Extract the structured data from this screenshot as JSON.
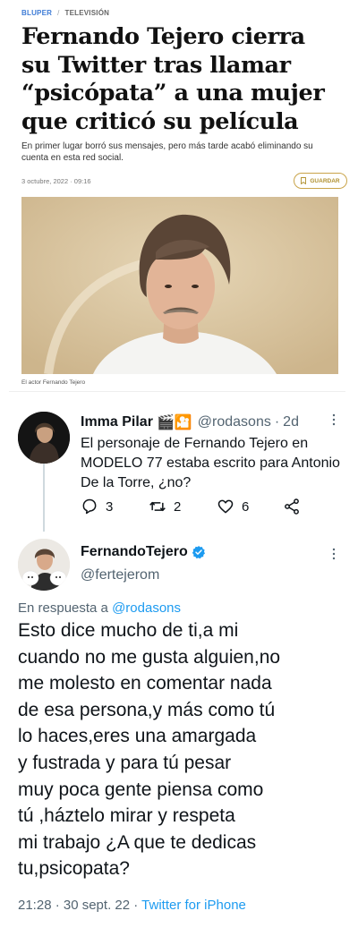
{
  "article": {
    "breadcrumb": {
      "section": "BLUPER",
      "separator": "/",
      "subsection": "TELEVISIÓN"
    },
    "headline": "Fernando Tejero cierra su Twitter tras llamar “psicópata” a una mujer que criticó su película",
    "subhead": "En primer lugar borró sus mensajes, pero más tarde acabó eliminando su cuenta en esta red social.",
    "date": "3 octubre, 2022 · 09:16",
    "save_label": "GUARDAR",
    "photo_caption": "El actor Fernando Tejero"
  },
  "reply_tweet": {
    "name": "Imma Pilar",
    "emojis": "🎬🎦",
    "handle": "@rodasons",
    "separator": "·",
    "time": "2d",
    "text": "El personaje de Fernando Tejero en MODELO 77 estaba escrito para Antonio De la Torre, ¿no?",
    "replies": "3",
    "retweets": "2",
    "likes": "6"
  },
  "main_tweet": {
    "name": "FernandoTejero",
    "handle": "@fertejerom",
    "in_reply_prefix": "En respuesta a",
    "in_reply_handle": "@rodasons",
    "text": "Esto dice mucho de ti,a mi\ncuando no me gusta alguien,no\nme molesto en comentar nada\nde esa persona,y más como tú\nlo haces,eres una amargada\ny fustrada y para tú pesar\nmuy poca gente piensa como\ntú ,háztelo mirar y respeta\nmi trabajo ¿A que te dedicas\ntu,psicopata?",
    "timestamp": "21:28 · 30 sept. 22 ·",
    "client": "Twitter for iPhone"
  },
  "colors": {
    "link_blue": "#1d9bf0",
    "secondary_text": "#536471",
    "verified_blue": "#1d9bf0",
    "breadcrumb_blue": "#3d7bd6",
    "save_gold": "#c9a44a"
  },
  "icons": [
    "save-bookmark-icon",
    "more-icon",
    "reply-icon",
    "retweet-icon",
    "like-icon",
    "share-icon",
    "verified-icon"
  ]
}
